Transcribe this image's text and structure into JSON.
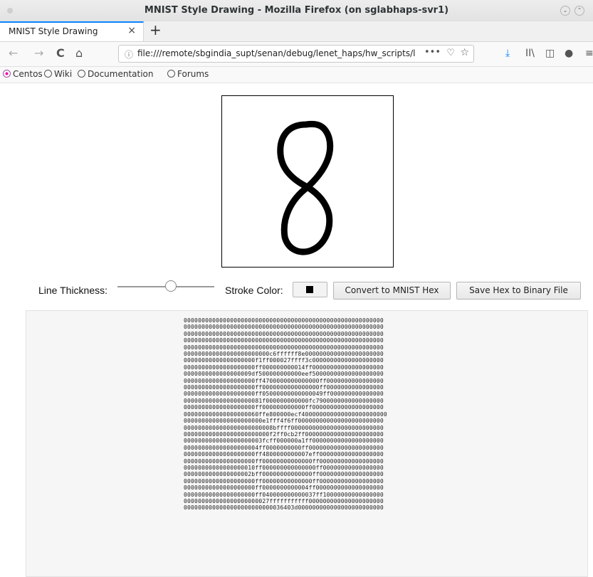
{
  "window": {
    "title": "MNIST Style Drawing - Mozilla Firefox (on sglabhaps-svr1)"
  },
  "tab": {
    "label": "MNIST Style Drawing",
    "close": "×",
    "new": "+"
  },
  "nav": {
    "back": "←",
    "forward": "→",
    "reload": "C",
    "home": "⌂",
    "url": "file:///remote/sbgindia_supt/senan/debug/lenet_haps/hw_scripts/l",
    "url_more": "•••",
    "info_icon": "ⓘ",
    "pocket": "♡",
    "star": "☆",
    "download": "⤓",
    "library": "II\\",
    "sidebar": "◫",
    "extension": "●",
    "menu": "≡"
  },
  "bookmarks": [
    {
      "label": "Centos",
      "icon": "centos-icon"
    },
    {
      "label": "Wiki",
      "icon": "globe-icon"
    },
    {
      "label": "Documentation",
      "icon": "globe-icon"
    },
    {
      "label": "Forums",
      "icon": "globe-icon"
    }
  ],
  "drawing": {
    "digit": "8",
    "stroke_color": "#000000",
    "background": "#ffffff"
  },
  "controls": {
    "line_thickness_label": "Line Thickness:",
    "line_thickness_value": 0.55,
    "stroke_color_label": "Stroke Color:",
    "convert_button": "Convert to MNIST Hex",
    "save_button": "Save Hex to Binary File"
  },
  "hex_output": [
    "00000000000000000000000000000000000000000000000000000000",
    "00000000000000000000000000000000000000000000000000000000",
    "00000000000000000000000000000000000000000000000000000000",
    "00000000000000000000000000000000000000000000000000000000",
    "00000000000000000000000000000000000000000000000000000000",
    "000000000000000000000000c6ffffff8e0000000000000000000000",
    "00000000000000000000f1ff000027ffff3c00000000000000000000",
    "00000000000000000000ff000000000014ff00000000000000000000",
    "0000000000000000009df500000000000eef50000000000000000000",
    "00000000000000000000ff4700000000000000ff0000000000000000",
    "00000000000000000000ff0000000000000000ff0000000000000000",
    "00000000000000000000ff05000000000000049ff000000000000000",
    "0000000000000000000081f000000000000fc7900000000000000000",
    "00000000000000000000ff000000000000ff00000000000000000000",
    "000000000000000000060ffe800000ecf400000000000000000000000",
    "0000000000000000000000e1fff4f6ff000000000000000000000000",
    "0000000000000000000000008bffff00000000000000000000000000",
    "000000000000000000000000f2ff0cb2ff0000000000000000000000",
    "0000000000000000000003fcff000000a1ff00000000000000000000",
    "000000000000000000004ff0000000000ff000000000000000000000",
    "00000000000000000000ff4800000000007eff000000000000000000",
    "00000000000000000000ff00000000000000ff000000000000000000",
    "00000000000000000010ff000000000000000ff00000000000000000",
    "0000000000000000002bff00000000000000ff000000000000000000",
    "00000000000000000000ff00000000000000ff000000000000000000",
    "00000000000000000000ff0000000000004ff0000000000000000000",
    "00000000000000000000ff040000000000037ff10000000000000000",
    "000000000000000000000027fffffffffff000000000000000000000",
    "0000000000000000000000000036403d000000000000000000000000"
  ]
}
